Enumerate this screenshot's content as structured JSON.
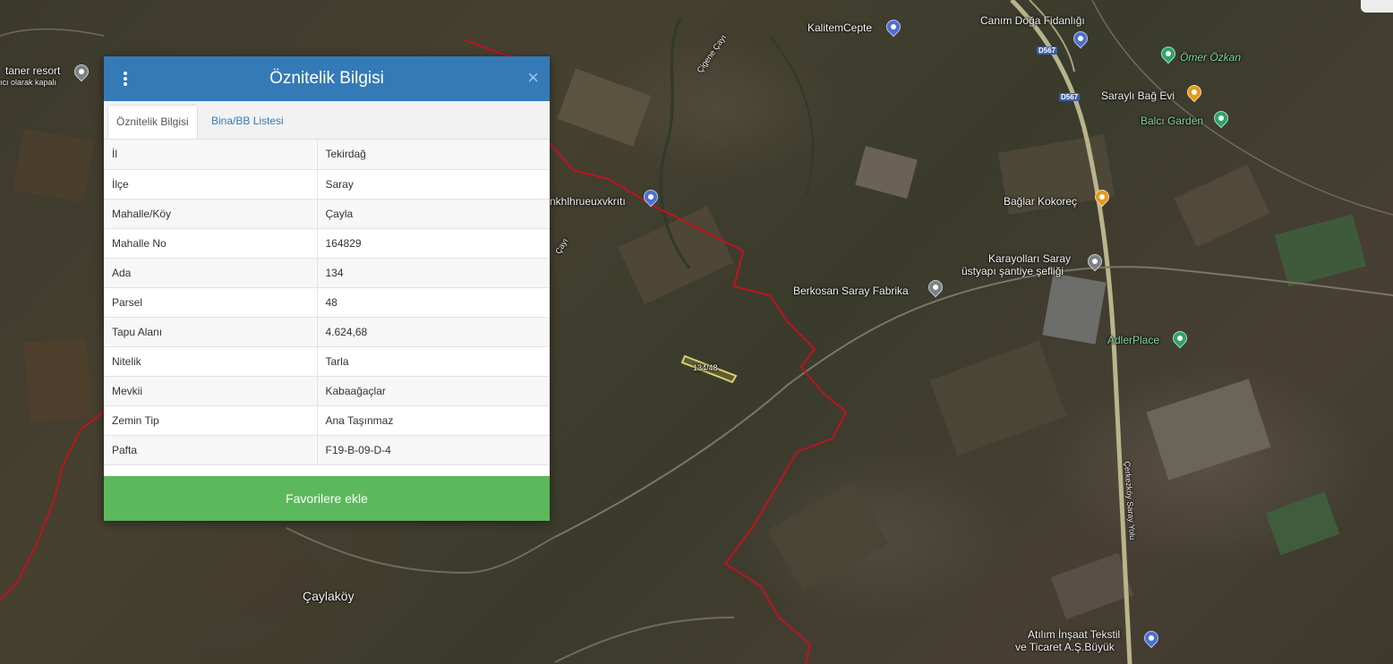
{
  "panel": {
    "title": "Öznitelik Bilgisi",
    "tabs": [
      {
        "label": "Öznitelik Bilgisi",
        "active": true
      },
      {
        "label": "Bina/BB Listesi",
        "active": false
      }
    ],
    "rows": [
      {
        "key": "İl",
        "value": "Tekirdağ"
      },
      {
        "key": "İlçe",
        "value": "Saray"
      },
      {
        "key": "Mahalle/Köy",
        "value": "Çayla"
      },
      {
        "key": "Mahalle No",
        "value": "164829"
      },
      {
        "key": "Ada",
        "value": "134"
      },
      {
        "key": "Parsel",
        "value": "48"
      },
      {
        "key": "Tapu Alanı",
        "value": "4.624,68"
      },
      {
        "key": "Nitelik",
        "value": "Tarla"
      },
      {
        "key": "Mevkii",
        "value": "Kabaağaçlar"
      },
      {
        "key": "Zemin Tip",
        "value": "Ana Taşınmaz"
      },
      {
        "key": "Pafta",
        "value": "F19-B-09-D-4"
      }
    ],
    "favorite_button": "Favorilere ekle",
    "header_color": "#337ab7",
    "button_color": "#5cb85c"
  },
  "map": {
    "labels": {
      "taner_resort": "taner resort",
      "taner_resort_sub": "ıcı olarak kapalı",
      "kalitemcepte": "KalitemCepte",
      "canim_doga": "Canım Doğa Fidanlığı",
      "omer_ozkan": "Ömer Özkan",
      "sarayli_bag": "Saraylı Bağ Evi",
      "balci_garden": "Balcı Garden",
      "baglar_kokorec": "Bağlar Kokoreç",
      "nkh": "nkhlhrueuxvkrıtı",
      "karayollari_1": "Karayolları Saray",
      "karayollari_2": "üstyapı şantiye şefliği",
      "berkosan": "Berkosan Saray Fabrika",
      "adlerplace": "AdlerPlace",
      "parcel": "134/48",
      "caylakoy": "Çaylaköy",
      "atilim_1": "Atılım İnşaat Tekstil",
      "atilim_2": "ve Ticaret A.Ş.Büyük",
      "road_cerkezkoy": "Çerkezköy Saray Yolu",
      "cigene": "Çigene Çayı",
      "cay": "Çayı",
      "road_d567_a": "D567",
      "road_d567_b": "D567"
    },
    "boundary_color": "#c1121f"
  }
}
